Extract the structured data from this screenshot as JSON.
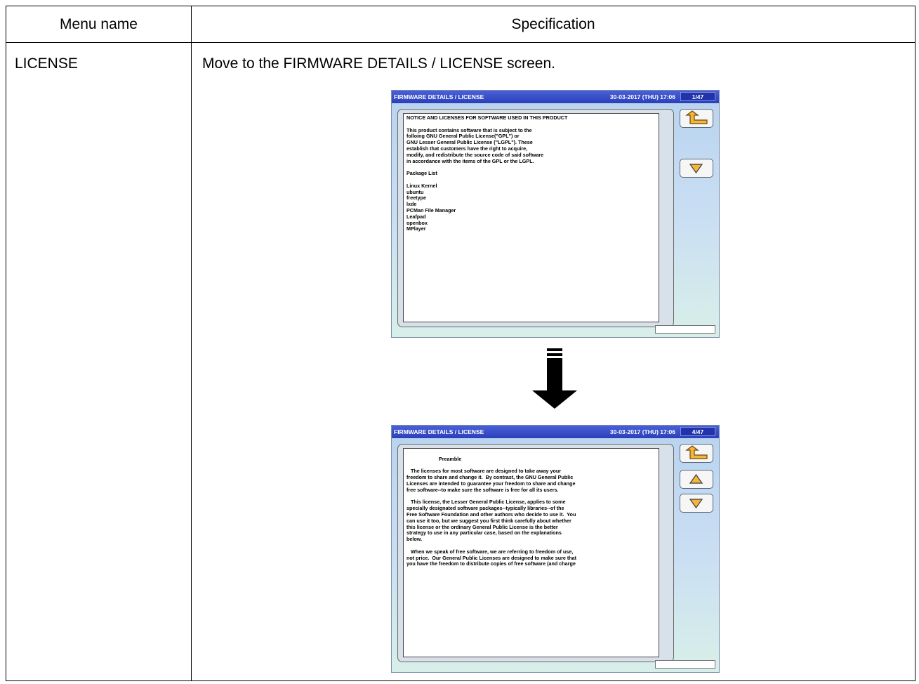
{
  "table": {
    "header_menu_name": "Menu name",
    "header_specification": "Specification",
    "menu_name": "LICENSE",
    "specification": "Move to the FIRMWARE DETAILS / LICENSE screen."
  },
  "screens": [
    {
      "title": "FIRMWARE DETAILS / LICENSE",
      "datetime": "30-03-2017 (THU)  17:06",
      "page": "1/47",
      "buttons": [
        "back",
        "down"
      ],
      "lines": [
        "NOTICE AND LICENSES FOR SOFTWARE USED IN THIS PRODUCT",
        "",
        "This product contains software that is subject to the",
        "folloing GNU General Public License(\"GPL\") or",
        "GNU Lesser General Public License (\"LGPL\"). These",
        "establish that customers have the right to acquire,",
        "modify, and redistribute the source code of said software",
        "in accordance with the items of the GPL or the LGPL.",
        "",
        "Package List",
        "",
        "Linux Kernel",
        "ubuntu",
        "freetype",
        "lxde",
        "PCMan File Manager",
        "Leafpad",
        "openbox",
        "MPlayer"
      ]
    },
    {
      "title": "FIRMWARE DETAILS / LICENSE",
      "datetime": "30-03-2017 (THU)  17:06",
      "page": "4/47",
      "buttons": [
        "back",
        "up",
        "down"
      ],
      "lines": [
        "",
        "                       Preamble",
        "",
        "   The licenses for most software are designed to take away your",
        "freedom to share and change it.  By contrast, the GNU General Public",
        "Licenses are intended to guarantee your freedom to share and change",
        "free software--to make sure the software is free for all its users.",
        "",
        "   This license, the Lesser General Public License, applies to some",
        "specially designated software packages--typically libraries--of the",
        "Free Software Foundation and other authors who decide to use it.  You",
        "can use it too, but we suggest you first think carefully about whether",
        "this license or the ordinary General Public License is the better",
        "strategy to use in any particular case, based on the explanations",
        "below.",
        "",
        "   When we speak of free software, we are referring to freedom of use,",
        "not price.  Our General Public Licenses are designed to make sure that",
        "you have the freedom to distribute copies of free software (and charge"
      ]
    }
  ],
  "icons": {
    "back": "return-arrow-icon",
    "up": "triangle-up-icon",
    "down": "triangle-down-icon",
    "transition": "big-down-arrow-icon"
  }
}
